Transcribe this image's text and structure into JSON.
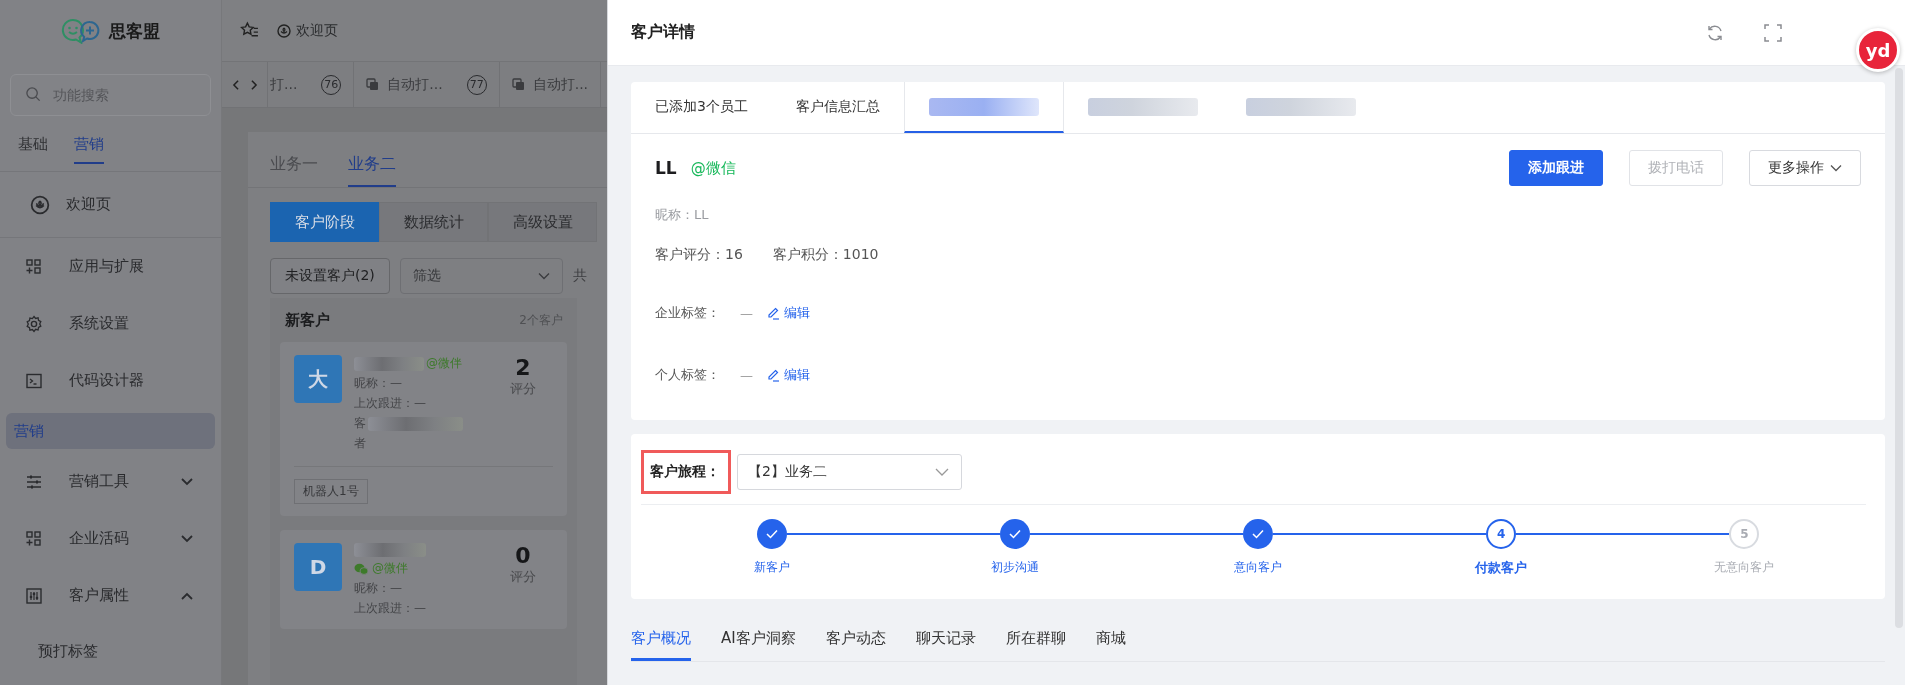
{
  "sidebar": {
    "brand": "思客盟",
    "search": {
      "placeholder": "功能搜索"
    },
    "tabs": [
      {
        "label": "基础",
        "selected": false
      },
      {
        "label": "营销",
        "selected": true
      }
    ],
    "pinned": {
      "label": "欢迎页"
    },
    "items": [
      {
        "label": "应用与扩展"
      },
      {
        "label": "系统设置"
      },
      {
        "label": "代码设计器"
      }
    ],
    "group": {
      "label": "营销",
      "selected": true,
      "children": [
        {
          "label": "营销工具",
          "expanded": false
        },
        {
          "label": "企业活码",
          "expanded": false
        },
        {
          "label": "客户属性",
          "expanded": true,
          "children": [
            {
              "label": "预打标签"
            }
          ]
        }
      ]
    }
  },
  "topbar": {
    "breadcrumb": "欢迎页"
  },
  "page_tabs": [
    {
      "label": "打...",
      "badge": "76",
      "cut": true
    },
    {
      "label": "自动打...",
      "badge": "77",
      "cut": false
    },
    {
      "label": "自动打...",
      "cut": false
    }
  ],
  "main": {
    "biz_tabs": [
      {
        "label": "业务一",
        "selected": false
      },
      {
        "label": "业务二",
        "selected": true
      }
    ],
    "segments": [
      {
        "label": "客户阶段",
        "selected": true
      },
      {
        "label": "数据统计",
        "selected": false
      },
      {
        "label": "高级设置",
        "selected": false
      }
    ],
    "unset_button": "未设置客户(2)",
    "filter": {
      "value": "筛选"
    },
    "total": "共",
    "column": {
      "title": "新客户",
      "count": "2个客户",
      "cards": [
        {
          "avatar": "大",
          "channel": "@微伴",
          "wechat": false,
          "nickname": "昵称：—",
          "last_follow": "上次跟进：—",
          "note": [
            "客",
            "者"
          ],
          "score": "2",
          "score_label": "评分",
          "tag": "机器人1号"
        },
        {
          "avatar": "D",
          "channel": "@微伴",
          "wechat": true,
          "nickname": "昵称：—",
          "last_follow": "上次跟进：—",
          "score": "0",
          "score_label": "评分"
        }
      ]
    }
  },
  "drawer": {
    "title": "客户详情",
    "tabs": [
      {
        "label": "已添加3个员工",
        "selected": false
      },
      {
        "label": "客户信息汇总",
        "selected": false
      },
      {
        "selected": true
      },
      {
        "selected": false
      },
      {
        "selected": false
      }
    ],
    "profile": {
      "name": "LL",
      "channel": "@微信",
      "nickname": "昵称：LL",
      "score": "客户评分：16",
      "points": "客户积分：1010",
      "tag_rows": [
        {
          "label": "企业标签：",
          "value": "—",
          "action": "编辑"
        },
        {
          "label": "个人标签：",
          "value": "—",
          "action": "编辑"
        }
      ]
    },
    "buttons": [
      {
        "label": "添加跟进",
        "kind": "primary",
        "disabled": false
      },
      {
        "label": "拨打电话",
        "kind": "default",
        "disabled": true
      },
      {
        "label": "更多操作",
        "kind": "dropdown",
        "disabled": false
      }
    ],
    "journey": {
      "label": "客户旅程：",
      "highlighted": true,
      "select": "【2】业务二",
      "steps": [
        {
          "label": "新客户",
          "done": true,
          "current": false
        },
        {
          "label": "初步沟通",
          "done": true,
          "current": false
        },
        {
          "label": "意向客户",
          "done": true,
          "current": false
        },
        {
          "label": "付款客户",
          "done": false,
          "current": true,
          "number": "4"
        },
        {
          "label": "无意向客户",
          "done": false,
          "current": false,
          "number": "5"
        }
      ]
    },
    "bottom_tabs": [
      {
        "label": "客户概况",
        "selected": true
      },
      {
        "label": "AI客户洞察",
        "selected": false
      },
      {
        "label": "客户动态",
        "selected": false
      },
      {
        "label": "聊天记录",
        "selected": false
      },
      {
        "label": "所在群聊",
        "selected": false
      },
      {
        "label": "商城",
        "selected": false
      }
    ]
  },
  "extension_badge": {
    "label": "yd"
  }
}
